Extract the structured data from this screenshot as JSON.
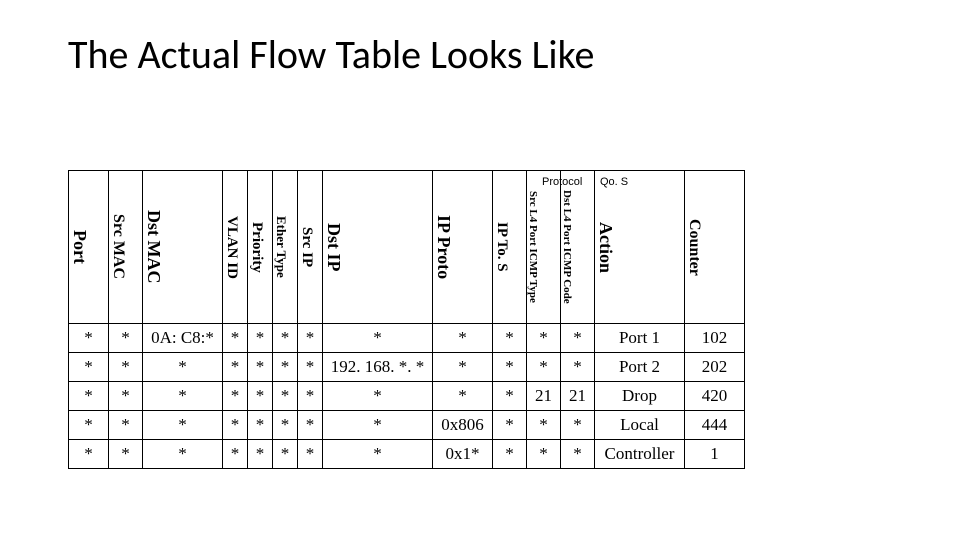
{
  "title": "The Actual Flow Table Looks Like",
  "notes": {
    "protocol": "Protocol",
    "qos": "Qo. S"
  },
  "headers": {
    "port": "Port",
    "src_mac": "Src MAC",
    "dst_mac": "Dst MAC",
    "vlan_id": "VLAN ID",
    "priority": "Priority",
    "ether_type": "Ether Type",
    "src_ip": "Src IP",
    "dst_ip": "Dst IP",
    "ip_proto": "IP Proto",
    "ip_tos": "IP To. S",
    "src_l4": "Src L4 Port ICMP Type",
    "dst_l4": "Dst L4 Port ICMP Code",
    "action": "Action",
    "counter": "Counter"
  },
  "rows": [
    {
      "port": "*",
      "src_mac": "*",
      "dst_mac": "0A: C8:*",
      "vlan_id": "*",
      "priority": "*",
      "ether_type": "*",
      "src_ip": "*",
      "dst_ip": "*",
      "ip_proto": "*",
      "ip_tos": "*",
      "src_l4": "*",
      "dst_l4": "*",
      "action": "Port 1",
      "counter": "102"
    },
    {
      "port": "*",
      "src_mac": "*",
      "dst_mac": "*",
      "vlan_id": "*",
      "priority": "*",
      "ether_type": "*",
      "src_ip": "*",
      "dst_ip": "192. 168. *. *",
      "ip_proto": "*",
      "ip_tos": "*",
      "src_l4": "*",
      "dst_l4": "*",
      "action": "Port 2",
      "counter": "202"
    },
    {
      "port": "*",
      "src_mac": "*",
      "dst_mac": "*",
      "vlan_id": "*",
      "priority": "*",
      "ether_type": "*",
      "src_ip": "*",
      "dst_ip": "*",
      "ip_proto": "*",
      "ip_tos": "*",
      "src_l4": "21",
      "dst_l4": "21",
      "action": "Drop",
      "counter": "420"
    },
    {
      "port": "*",
      "src_mac": "*",
      "dst_mac": "*",
      "vlan_id": "*",
      "priority": "*",
      "ether_type": "*",
      "src_ip": "*",
      "dst_ip": "*",
      "ip_proto": "0x806",
      "ip_tos": "*",
      "src_l4": "*",
      "dst_l4": "*",
      "action": "Local",
      "counter": "444"
    },
    {
      "port": "*",
      "src_mac": "*",
      "dst_mac": "*",
      "vlan_id": "*",
      "priority": "*",
      "ether_type": "*",
      "src_ip": "*",
      "dst_ip": "*",
      "ip_proto": "0x1*",
      "ip_tos": "*",
      "src_l4": "*",
      "dst_l4": "*",
      "action": "Controller",
      "counter": "1"
    }
  ],
  "chart_data": {
    "type": "table",
    "columns": [
      "Port",
      "Src MAC",
      "Dst MAC",
      "VLAN ID",
      "Priority",
      "Ether Type",
      "Src IP",
      "Dst IP",
      "IP Proto",
      "IP To. S",
      "Src L4 Port ICMP Type",
      "Dst L4 Port ICMP Code",
      "Action",
      "Counter"
    ],
    "data": [
      [
        "*",
        "*",
        "0A: C8:*",
        "*",
        "*",
        "*",
        "*",
        "*",
        "*",
        "*",
        "*",
        "*",
        "Port 1",
        102
      ],
      [
        "*",
        "*",
        "*",
        "*",
        "*",
        "*",
        "*",
        "192. 168. *. *",
        "*",
        "*",
        "*",
        "*",
        "Port 2",
        202
      ],
      [
        "*",
        "*",
        "*",
        "*",
        "*",
        "*",
        "*",
        "*",
        "*",
        "*",
        "21",
        "21",
        "Drop",
        420
      ],
      [
        "*",
        "*",
        "*",
        "*",
        "*",
        "*",
        "*",
        "*",
        "0x806",
        "*",
        "*",
        "*",
        "Local",
        444
      ],
      [
        "*",
        "*",
        "*",
        "*",
        "*",
        "*",
        "*",
        "*",
        "0x1*",
        "*",
        "*",
        "*",
        "Controller",
        1
      ]
    ]
  }
}
